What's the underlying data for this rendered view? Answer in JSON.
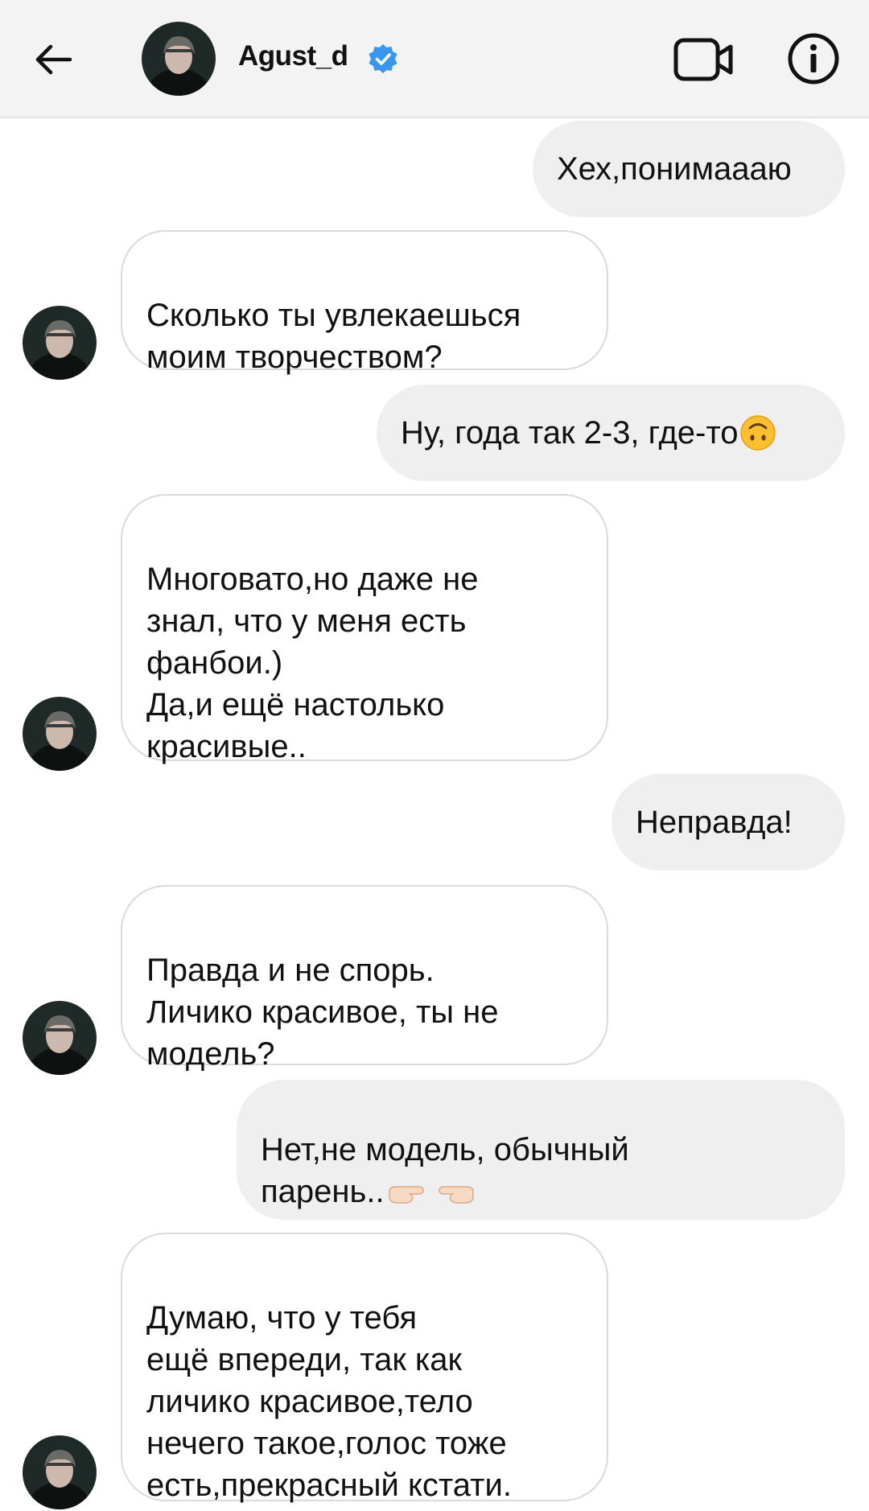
{
  "header": {
    "username": "Agust_d",
    "verified": true,
    "icons": {
      "back": "arrow-left-icon",
      "video": "video-call-icon",
      "info": "info-icon",
      "verified": "verified-badge-icon"
    }
  },
  "messages": [
    {
      "side": "out",
      "text": "Хех,понимаааю"
    },
    {
      "side": "in",
      "text": "Сколько ты увлекаешься\nмоим творчеством?"
    },
    {
      "side": "out",
      "text": "Ну, года так 2-3, где-то",
      "emoji": "upside-down-face"
    },
    {
      "side": "in",
      "text": "Многовато,но даже не\nзнал, что у меня есть\nфанбои.)\nДа,и ещё настолько\nкрасивые.."
    },
    {
      "side": "out",
      "text": "Неправда!"
    },
    {
      "side": "in",
      "text": "Правда и не спорь.\nЛичико красивое, ты не\nмодель?"
    },
    {
      "side": "out",
      "text": "Нет,не модель, обычный\nпарень..",
      "emoji": "pointing-hands"
    },
    {
      "side": "in",
      "text": "Думаю, что у тебя\nещё впереди, так как\nличико красивое,тело\nнечего такое,голос тоже\nесть,прекрасный кстати."
    }
  ],
  "colors": {
    "header_bg": "#f3f3f3",
    "outgoing_bubble": "#efefef",
    "incoming_border": "#dadada",
    "verified_blue": "#3897f0",
    "text": "#111111"
  }
}
